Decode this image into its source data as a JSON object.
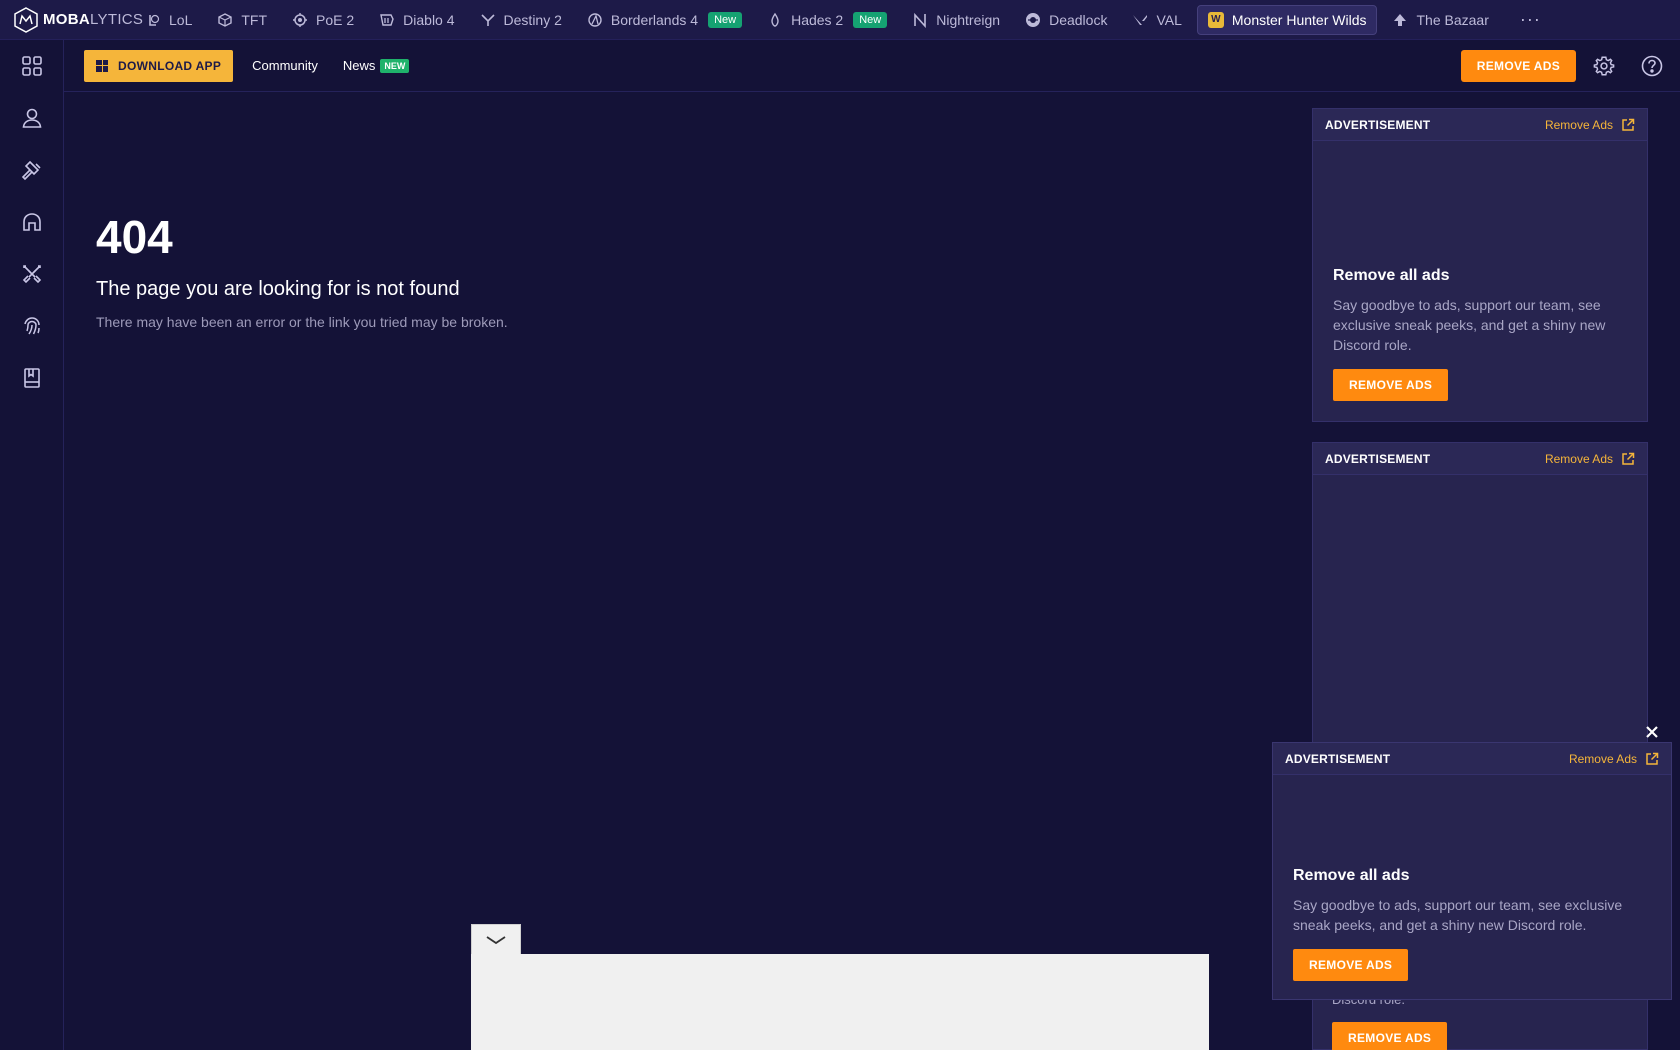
{
  "brand": {
    "bold": "MOBA",
    "light": "LYTICS"
  },
  "games": [
    {
      "label": "LoL",
      "icon": "lol-icon",
      "badge": ""
    },
    {
      "label": "TFT",
      "icon": "tft-icon",
      "badge": ""
    },
    {
      "label": "PoE 2",
      "icon": "poe2-icon",
      "badge": ""
    },
    {
      "label": "Diablo 4",
      "icon": "diablo4-icon",
      "badge": ""
    },
    {
      "label": "Destiny 2",
      "icon": "destiny2-icon",
      "badge": ""
    },
    {
      "label": "Borderlands 4",
      "icon": "borderlands4-icon",
      "badge": "New"
    },
    {
      "label": "Hades 2",
      "icon": "hades2-icon",
      "badge": "New"
    },
    {
      "label": "Nightreign",
      "icon": "nightreign-icon",
      "badge": ""
    },
    {
      "label": "Deadlock",
      "icon": "deadlock-icon",
      "badge": ""
    },
    {
      "label": "VAL",
      "icon": "valorant-icon",
      "badge": ""
    },
    {
      "label": "Monster Hunter Wilds",
      "icon": "mhw-icon",
      "badge": "",
      "active": true,
      "icon_letter": "W"
    },
    {
      "label": "The Bazaar",
      "icon": "bazaar-icon",
      "badge": ""
    }
  ],
  "more": "···",
  "subheader": {
    "download": "DOWNLOAD APP",
    "community": "Community",
    "news": "News",
    "news_badge": "NEW",
    "remove_ads": "REMOVE ADS"
  },
  "sidebar": [
    "apps-icon",
    "profile-icon",
    "builds-icon",
    "helmet-icon",
    "weapon-icon",
    "fingerprint-icon",
    "guide-book-icon"
  ],
  "error": {
    "code": "404",
    "title": "The page you are looking for is not found",
    "subtitle": "There may have been an error or the link you tried may be broken."
  },
  "ads": {
    "label": "ADVERTISEMENT",
    "remove_link": "Remove Ads",
    "promo_title": "Remove all ads",
    "promo_text": "Say goodbye to ads, support our team, see exclusive sneak peeks, and get a shiny new Discord role.",
    "promo_button": "REMOVE ADS",
    "underlap_text": "Discord role."
  },
  "colors": {
    "bg": "#141237",
    "topnav": "#1d1a48",
    "accent_orange": "#ff8a0f",
    "accent_yellow": "#f5b53a",
    "badge_green": "#15a272"
  }
}
